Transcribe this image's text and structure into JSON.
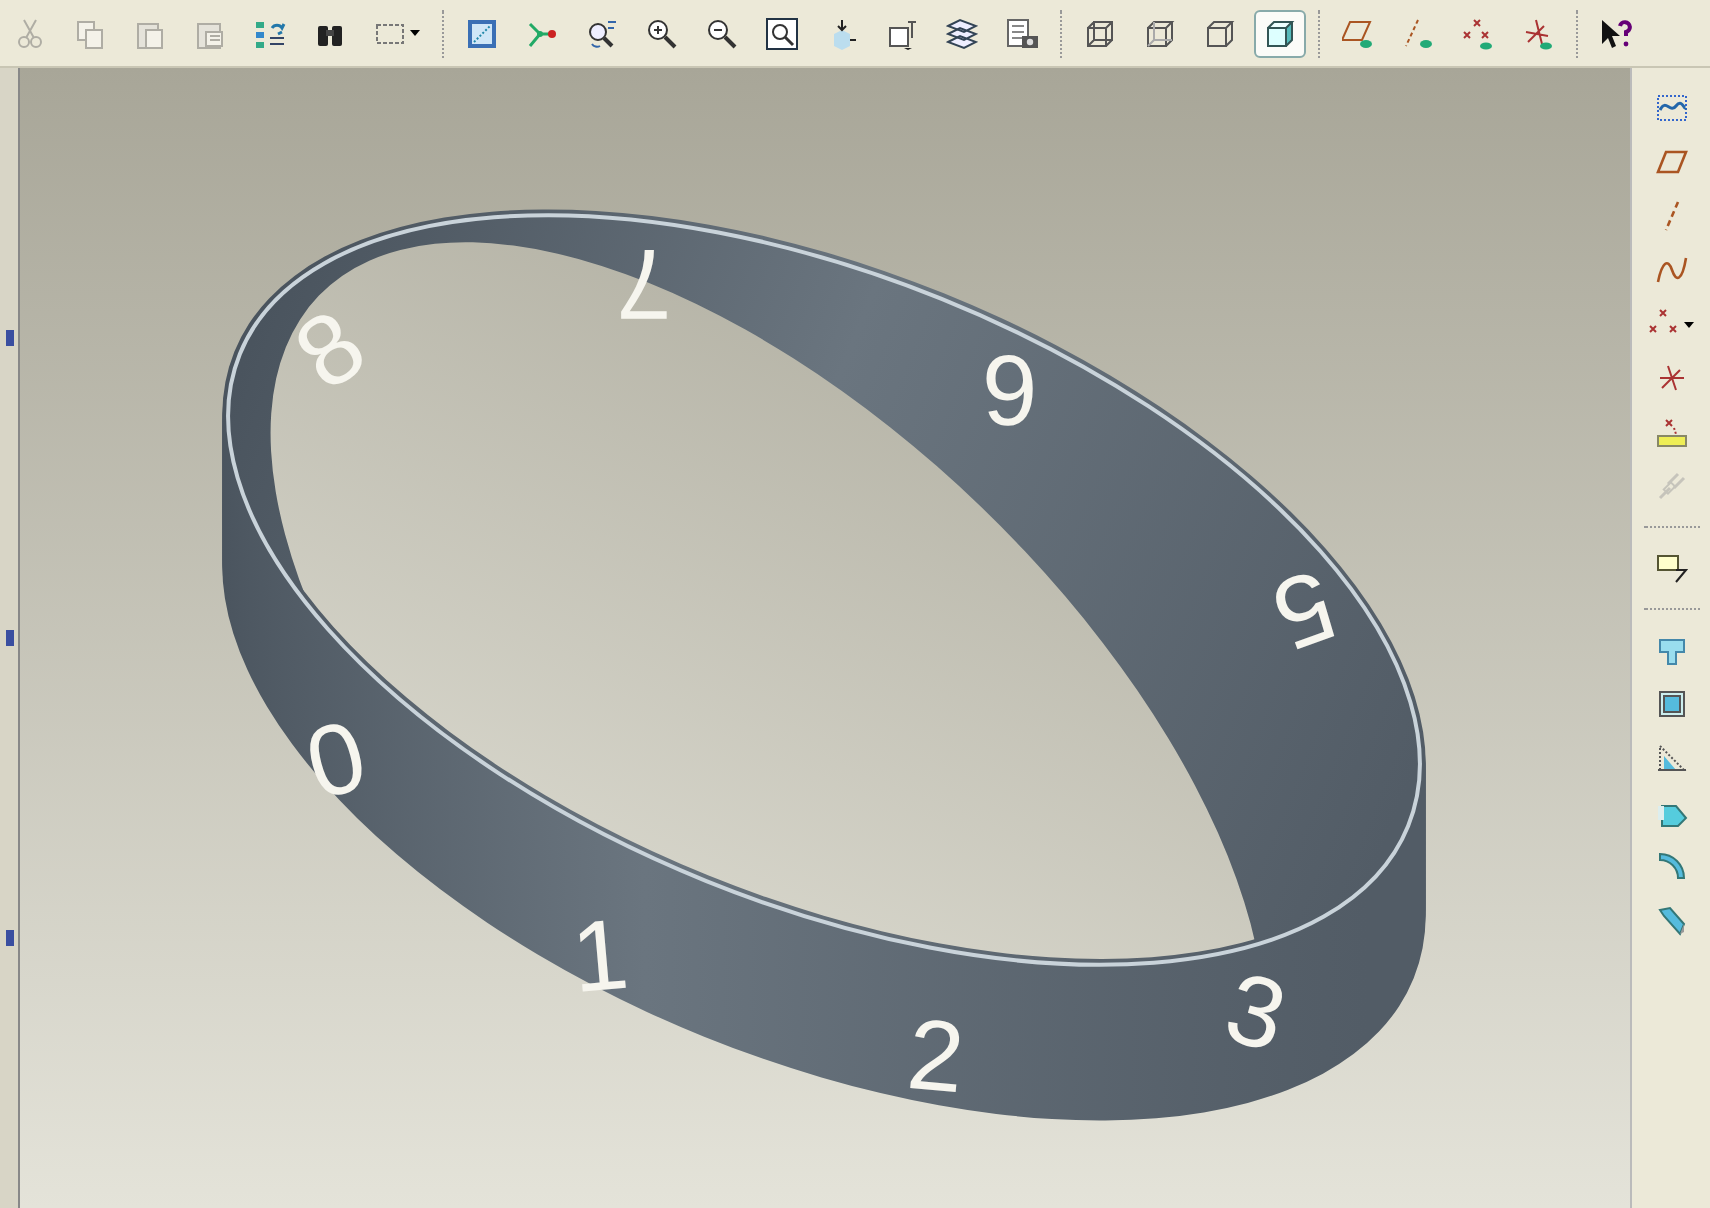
{
  "top_toolbar": {
    "groups": [
      {
        "buttons": [
          {
            "disabled": true
          },
          {
            "disabled": true
          },
          {
            "disabled": true
          },
          {
            "disabled": true
          },
          {
            "disabled": false
          },
          {
            "disabled": false
          },
          {
            "disabled": false
          }
        ]
      },
      {
        "buttons": [
          {
            "disabled": false
          },
          {
            "disabled": false
          },
          {
            "disabled": false
          },
          {
            "disabled": false
          },
          {
            "disabled": false
          },
          {
            "disabled": false
          },
          {
            "disabled": false
          },
          {
            "disabled": false
          },
          {
            "disabled": false
          },
          {
            "disabled": false
          }
        ]
      },
      {
        "buttons": [
          {
            "selected": false
          },
          {
            "selected": false
          },
          {
            "selected": false
          },
          {
            "selected": true
          }
        ]
      },
      {
        "buttons": [
          {
            "disabled": false
          },
          {
            "disabled": false
          },
          {
            "disabled": false
          },
          {
            "disabled": false
          }
        ]
      },
      {
        "buttons": [
          {
            "disabled": false
          }
        ]
      }
    ]
  },
  "right_toolbar": {
    "groups": [
      {
        "buttons": [
          {
            "disabled": false
          },
          {
            "disabled": false
          },
          {
            "disabled": false
          },
          {
            "disabled": false
          },
          {
            "disabled": false
          },
          {
            "disabled": false
          },
          {
            "disabled": false
          },
          {
            "disabled": true
          }
        ]
      },
      {
        "buttons": [
          {
            "disabled": false
          }
        ]
      },
      {
        "buttons": [
          {
            "disabled": false
          },
          {
            "disabled": false
          },
          {
            "disabled": false
          },
          {
            "disabled": false
          },
          {
            "disabled": false
          },
          {
            "disabled": false
          }
        ]
      }
    ]
  },
  "model": {
    "numerals": [
      "7",
      "6",
      "5",
      "8",
      "0",
      "1",
      "2",
      "3"
    ]
  }
}
